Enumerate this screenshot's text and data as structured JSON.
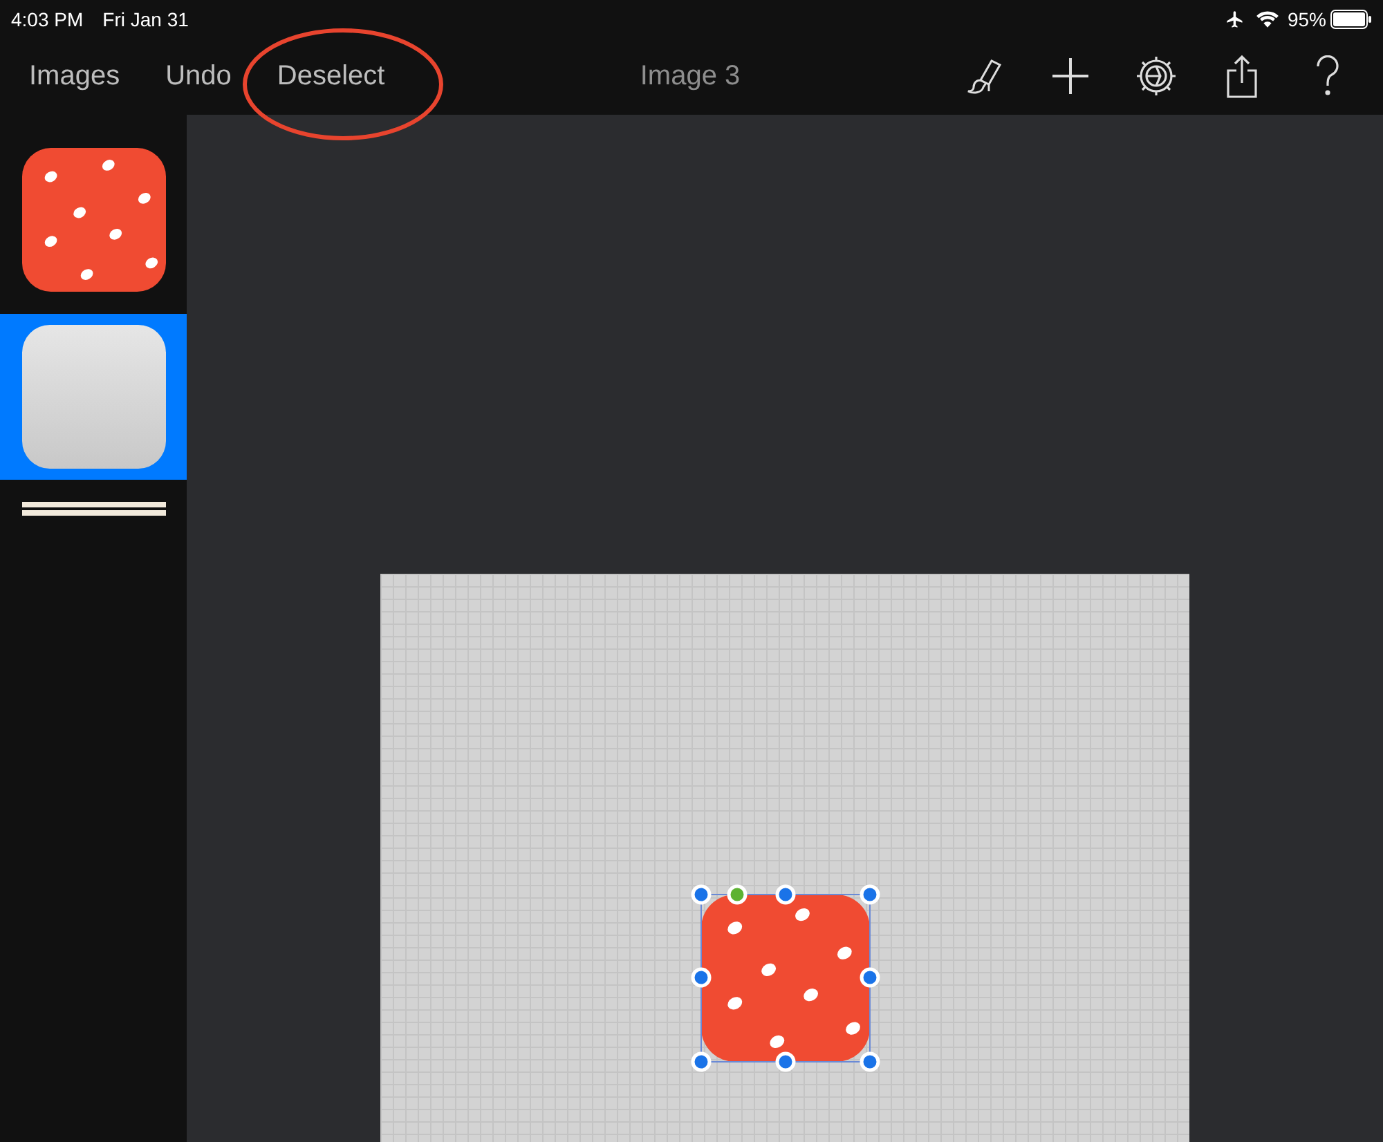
{
  "status_bar": {
    "time": "4:03 PM",
    "date": "Fri Jan 31",
    "battery": "95%"
  },
  "toolbar": {
    "buttons": [
      {
        "label": "Images"
      },
      {
        "label": "Undo"
      },
      {
        "label": "Deselect",
        "circled": true
      }
    ],
    "title": "Image 3"
  },
  "sidebar": {
    "items": [
      {
        "kind": "pattern",
        "selected": false
      },
      {
        "kind": "gradient",
        "selected": true
      },
      {
        "kind": "stripes",
        "selected": false
      }
    ]
  },
  "canvas": {
    "shape": {
      "kind": "pattern",
      "selected": true
    }
  }
}
